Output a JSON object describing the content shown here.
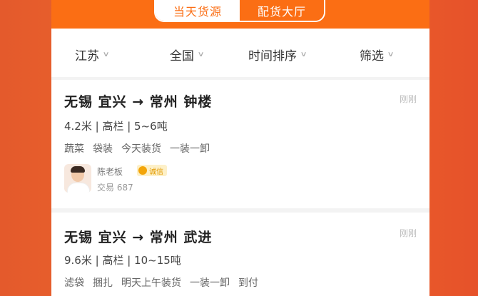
{
  "header": {
    "tabs": [
      {
        "label": "当天货源",
        "active": true
      },
      {
        "label": "配货大厅",
        "active": false
      }
    ]
  },
  "filters": [
    {
      "label": "江苏"
    },
    {
      "label": "全国"
    },
    {
      "label": "时间排序"
    },
    {
      "label": "筛选"
    }
  ],
  "cards": [
    {
      "route": "无锡 宜兴 → 常州 钟楼",
      "time": "刚刚",
      "spec": "4.2米 | 高栏 | 5~6吨",
      "tags": [
        "蔬菜",
        "袋装",
        "今天装货",
        "一装一卸"
      ],
      "owner": "陈老板",
      "badge": "诚信",
      "trades": "交易 687"
    },
    {
      "route": "无锡 宜兴 → 常州 武进",
      "time": "刚刚",
      "spec": "9.6米 | 高栏 | 10~15吨",
      "tags": [
        "滤袋",
        "捆扎",
        "明天上午装货",
        "一装一卸",
        "到付"
      ]
    }
  ],
  "colors": {
    "brand": "#fb6e14",
    "background": "#e45a2c"
  }
}
